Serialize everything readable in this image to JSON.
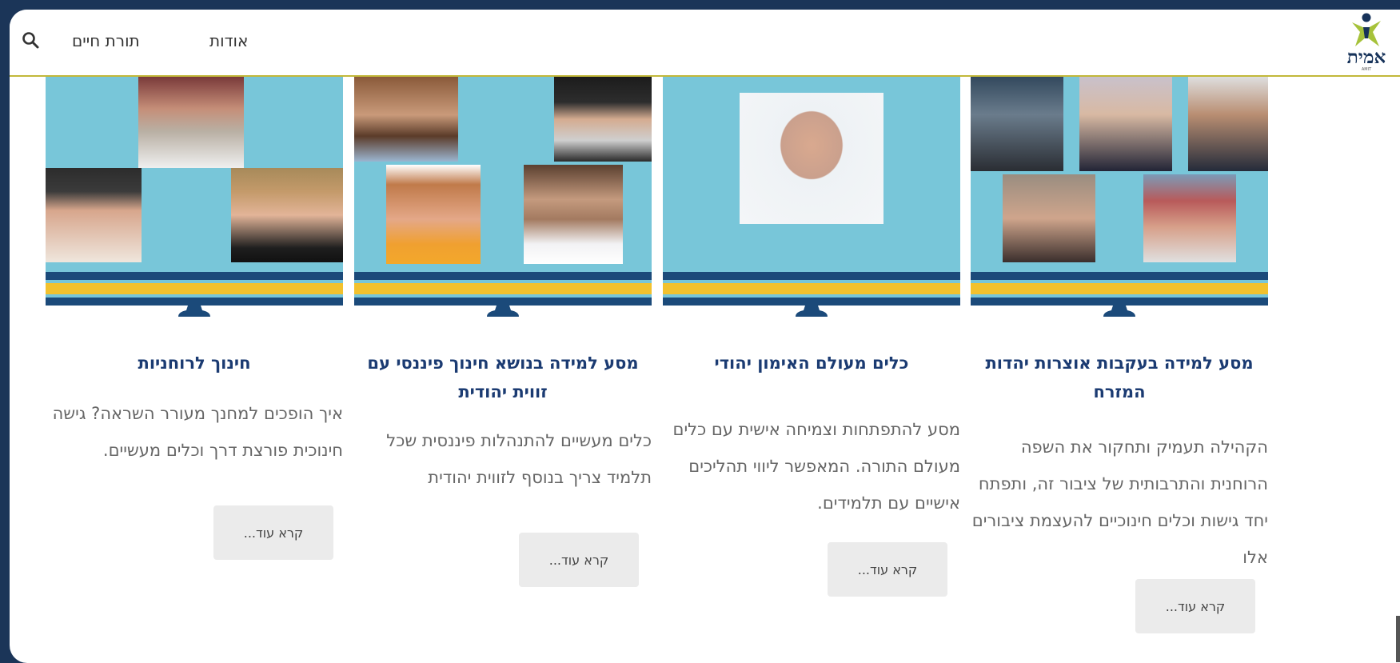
{
  "header": {
    "logo_text": "אמית",
    "logo_subtitle": "AMIT",
    "nav": {
      "about": "אודות",
      "torat_chaim": "תורת חיים"
    },
    "search_icon": "search-icon"
  },
  "cards": [
    {
      "title": "מסע למידה בעקבות אוצרות יהדות המזרח",
      "description": "הקהילה תעמיק ותחקור את השפה הרוחנית והתרבותית של ציבור זה, ותפתח יחד גישות וכלים חינוכיים להעצמת ציבורים אלו",
      "button": "קרא עוד..."
    },
    {
      "title": "כלים מעולם האימון יהודי",
      "description": "מסע להתפתחות וצמיחה אישית עם כלים מעולם התורה. המאפשר ליווי תהליכים אישיים עם תלמידים.",
      "button": "קרא עוד..."
    },
    {
      "title": "מסע למידה בנושא חינוך פיננסי עם זווית יהודית",
      "description": "כלים מעשיים להתנהלות פיננסית שכל תלמיד צריך בנוסף לזווית יהודית",
      "button": "קרא עוד..."
    },
    {
      "title": "חינוך לרוחניות",
      "description": "איך הופכים למחנך מעורר השראה? גישה חינוכית פורצת דרך וכלים מעשיים.",
      "button": "קרא עוד..."
    }
  ],
  "colors": {
    "frame_bg": "#1b3558",
    "screen": "#78c6d9",
    "stripe_blue": "#1b4a7a",
    "stripe_yellow": "#f2c12e",
    "title": "#1b3b72",
    "text": "#666666",
    "logo_green": "#a6c23a",
    "logo_navy": "#17335a"
  }
}
